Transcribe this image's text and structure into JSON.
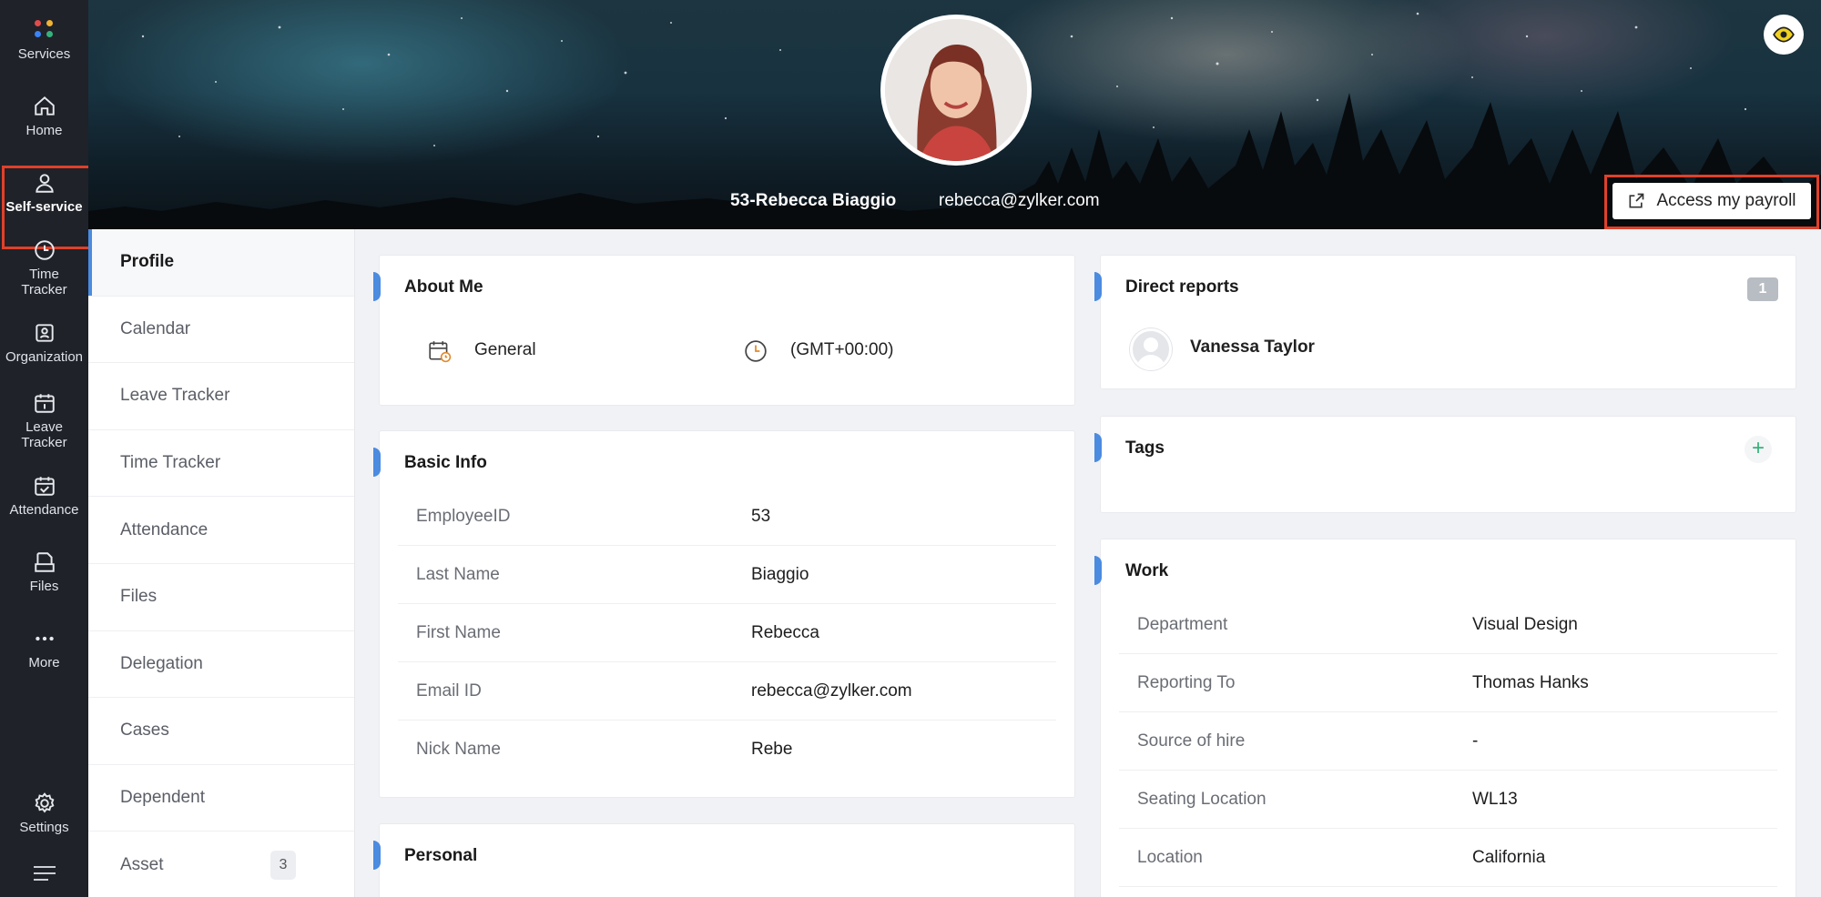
{
  "rail": {
    "items": [
      {
        "label": "Services",
        "icon": "services-icon"
      },
      {
        "label": "Home",
        "icon": "home-icon"
      },
      {
        "label": "Self-service",
        "icon": "person-icon",
        "active": true
      },
      {
        "label": "Time\nTracker",
        "icon": "clock-icon"
      },
      {
        "label": "Organization",
        "icon": "organization-icon"
      },
      {
        "label": "Leave\nTracker",
        "icon": "calendar-icon"
      },
      {
        "label": "Attendance",
        "icon": "attendance-icon"
      },
      {
        "label": "Files",
        "icon": "files-icon"
      },
      {
        "label": "More",
        "icon": "more-icon"
      },
      {
        "label": "Settings",
        "icon": "gear-icon"
      }
    ],
    "menu_icon": "hamburger-icon"
  },
  "banner": {
    "name": "53-Rebecca Biaggio",
    "email": "rebecca@zylker.com",
    "payroll_label": "Access my payroll",
    "eye_icon": "eye-icon",
    "payroll_icon": "external-link-icon"
  },
  "subnav": {
    "items": [
      {
        "label": "Profile",
        "active": true
      },
      {
        "label": "Calendar"
      },
      {
        "label": "Leave Tracker"
      },
      {
        "label": "Time Tracker"
      },
      {
        "label": "Attendance"
      },
      {
        "label": "Files"
      },
      {
        "label": "Delegation"
      },
      {
        "label": "Cases"
      },
      {
        "label": "Dependent"
      },
      {
        "label": "Asset",
        "badge": "3"
      }
    ]
  },
  "about": {
    "title": "About Me",
    "shift": "General",
    "timezone": "(GMT+00:00)"
  },
  "basic": {
    "title": "Basic Info",
    "rows": [
      {
        "key": "EmployeeID",
        "value": "53"
      },
      {
        "key": "Last Name",
        "value": "Biaggio"
      },
      {
        "key": "First Name",
        "value": "Rebecca"
      },
      {
        "key": "Email ID",
        "value": "rebecca@zylker.com"
      },
      {
        "key": "Nick Name",
        "value": "Rebe"
      }
    ]
  },
  "personal": {
    "title": "Personal"
  },
  "direct_reports": {
    "title": "Direct reports",
    "count": "1",
    "person": "Vanessa Taylor"
  },
  "tags": {
    "title": "Tags"
  },
  "work": {
    "title": "Work",
    "rows": [
      {
        "key": "Department",
        "value": "Visual Design"
      },
      {
        "key": "Reporting To",
        "value": "Thomas Hanks"
      },
      {
        "key": "Source of hire",
        "value": "-"
      },
      {
        "key": "Seating Location",
        "value": "WL13"
      },
      {
        "key": "Location",
        "value": "California"
      }
    ]
  },
  "colors": {
    "accent": "#4b8be0",
    "highlight": "#e0402a",
    "rail_bg": "#1f2229",
    "plus": "#35b27c"
  }
}
